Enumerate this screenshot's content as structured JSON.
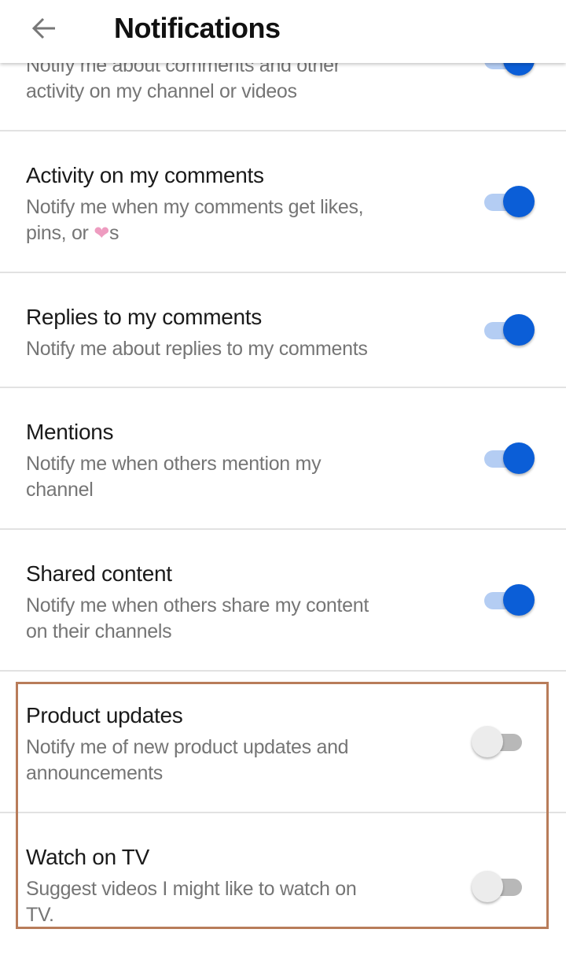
{
  "header": {
    "title": "Notifications",
    "back_icon": "arrow-left-icon"
  },
  "colors": {
    "accent": "#0b5ed7",
    "highlight_border": "#b87c5a",
    "heart": "#ee9cc0"
  },
  "rows": [
    {
      "desc_lines": [
        "Notify me about comments and other",
        "activity on my channel or videos"
      ],
      "enabled": true
    },
    {
      "title": "Activity on my comments",
      "desc_lines": [
        "Notify me when my comments get likes,"
      ],
      "desc_line2_prefix": "pins, or ",
      "desc_line2_suffix": "s",
      "heart_icon": "heart-icon",
      "enabled": true
    },
    {
      "title": "Replies to my comments",
      "desc_lines": [
        "Notify me about replies to my comments"
      ],
      "enabled": true
    },
    {
      "title": "Mentions",
      "desc_lines": [
        "Notify me when others mention my",
        "channel"
      ],
      "enabled": true
    },
    {
      "title": "Shared content",
      "desc_lines": [
        "Notify me when others share my content",
        "on their channels"
      ],
      "enabled": true
    },
    {
      "title": "Product updates",
      "desc_lines": [
        "Notify me of new product updates and",
        "announcements"
      ],
      "enabled": false
    },
    {
      "title": "Watch on TV",
      "desc_lines": [
        "Suggest videos I might like to watch on",
        "TV."
      ],
      "enabled": false
    }
  ]
}
